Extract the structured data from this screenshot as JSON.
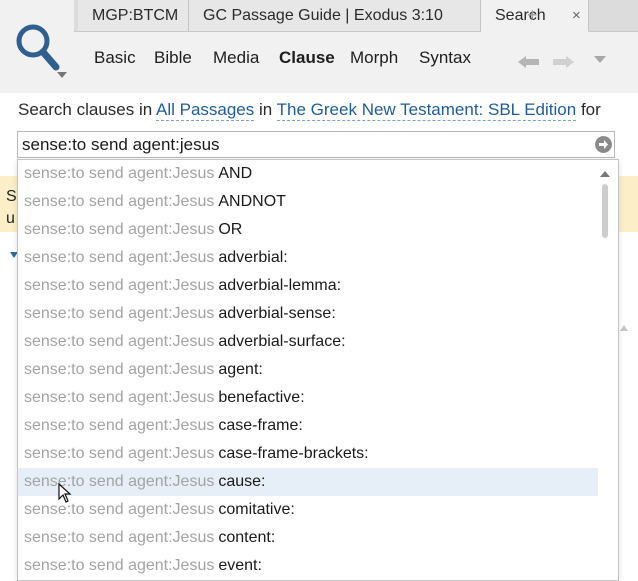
{
  "tabs": [
    {
      "label": "MGP:BTCM"
    },
    {
      "label": "GC Passage Guide | Exodus 3:10"
    },
    {
      "label": "Search",
      "close": "×"
    }
  ],
  "new_tab": "+",
  "subnav": [
    "Basic",
    "Bible",
    "Media",
    "Clause",
    "Morph",
    "Syntax"
  ],
  "search_line": {
    "prefix": "Search clauses in",
    "scope": "All Passages",
    "in": "in",
    "resource": "The Greek New Testament: SBL Edition",
    "suffix": "for"
  },
  "query": "sense:to send agent:jesus",
  "banner": {
    "line1": "S",
    "line2": "u"
  },
  "suggestions": {
    "prefix": "sense:to send agent:Jesus",
    "items": [
      "AND",
      "ANDNOT",
      "OR",
      "adverbial:",
      "adverbial-lemma:",
      "adverbial-sense:",
      "adverbial-surface:",
      "agent:",
      "benefactive:",
      "case-frame:",
      "case-frame-brackets:",
      "cause:",
      "comitative:",
      "content:",
      "event:"
    ],
    "highlighted_index": 11
  },
  "icons": [
    "search-icon",
    "close-icon",
    "plus-icon",
    "back-arrow-icon",
    "forward-arrow-icon",
    "chevron-down-icon",
    "go-arrow-icon",
    "mouse-cursor-icon"
  ],
  "colors": {
    "link": "#1f5c9a",
    "banner": "#fcefc8",
    "highlight": "#e6eef7"
  }
}
